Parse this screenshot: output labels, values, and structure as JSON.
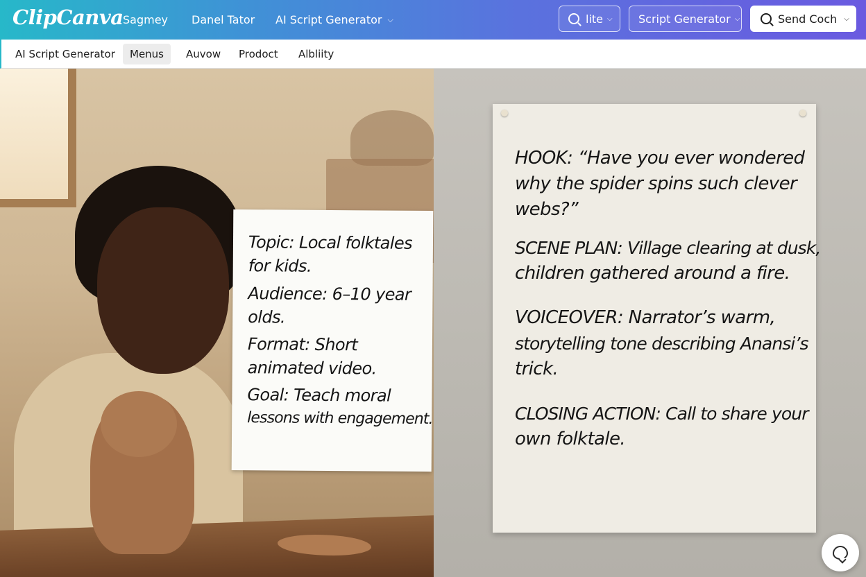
{
  "app": {
    "logo": "ClipCanva"
  },
  "topnav": {
    "items": [
      {
        "label": "Sagmey"
      },
      {
        "label": "Danel Tator"
      },
      {
        "label": "AI Script Generator",
        "icon": "chevron-down-icon"
      }
    ],
    "search_pill": {
      "label": "lite",
      "icon": "search-icon"
    },
    "generator_pill": {
      "label": "Script Generator"
    },
    "account_pill": {
      "label": "Send Coch",
      "icon": "search-icon"
    }
  },
  "subnav": {
    "tabs": [
      {
        "label": "AI Script Generator",
        "active": false
      },
      {
        "label": "Menus",
        "active": true
      },
      {
        "label": "Auvow",
        "active": false
      },
      {
        "label": "Prodoct",
        "active": false
      },
      {
        "label": "Albliity",
        "active": false
      }
    ]
  },
  "left_note": {
    "lines": [
      "Topic: Local folktales",
      "for kids.",
      "Audience: 6–10 year",
      "olds.",
      "Format: Short",
      "animated video.",
      "Goal: Teach moral",
      "lessons with engagement."
    ]
  },
  "right_note": {
    "lines": [
      "HOOK: “Have you ever wondered",
      "why the spider spins such clever",
      "webs?”",
      "SCENE PLAN: Village clearing at dusk,",
      "children gathered around a fire.",
      "VOICEOVER: Narrator’s warm,",
      "storytelling tone describing Anansi’s",
      "trick.",
      "CLOSING ACTION: Call to share your",
      "own folktale."
    ]
  },
  "chat": {
    "icon": "chat-bubble-icon"
  },
  "colors": {
    "header_gradient_start": "#27b8c9",
    "header_gradient_end": "#6a5ae0",
    "note_ink": "#151515"
  }
}
